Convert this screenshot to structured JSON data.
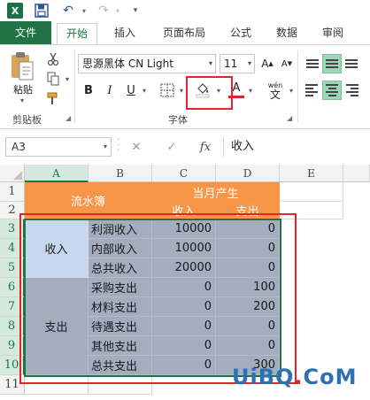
{
  "app": {
    "logo_letter": "X"
  },
  "qat": {
    "save_icon": "save-icon",
    "undo_icon": "undo-icon",
    "redo_icon": "redo-icon"
  },
  "tabs": [
    {
      "label": "文件"
    },
    {
      "label": "开始",
      "active": true
    },
    {
      "label": "插入"
    },
    {
      "label": "页面布局"
    },
    {
      "label": "公式"
    },
    {
      "label": "数据"
    },
    {
      "label": "审阅"
    }
  ],
  "ribbon": {
    "clipboard": {
      "paste_label": "粘贴",
      "group_label": "剪贴板"
    },
    "font": {
      "font_name": "思源黑体 CN Light",
      "font_size": "11",
      "bold": "B",
      "italic": "I",
      "underline": "U",
      "font_color_letter": "A",
      "phonetic_label": "wén",
      "group_label": "字体"
    },
    "highlight_color": "#e0262a",
    "accent_color": "#217346"
  },
  "formula_bar": {
    "name_box": "A3",
    "cancel": "✕",
    "confirm": "✓",
    "fx": "fx",
    "content": "收入"
  },
  "sheet": {
    "columns": [
      "A",
      "B",
      "C",
      "D",
      "E"
    ],
    "selected_column": "A",
    "rows": [
      "1",
      "2",
      "3",
      "4",
      "5",
      "6",
      "7",
      "8",
      "9",
      "10",
      "11"
    ],
    "title_cells": {
      "ledger": "流水簿",
      "current_month": "当月产生",
      "income_header": "收入",
      "expense_header": "支出"
    },
    "group_labels": {
      "income": "收入",
      "expense": "支出"
    },
    "data_rows": [
      {
        "label": "利润收入",
        "income": "10000",
        "expense": "0"
      },
      {
        "label": "内部收入",
        "income": "10000",
        "expense": "0"
      },
      {
        "label": "总共收入",
        "income": "20000",
        "expense": "0"
      },
      {
        "label": "采购支出",
        "income": "0",
        "expense": "100"
      },
      {
        "label": "材料支出",
        "income": "0",
        "expense": "200"
      },
      {
        "label": "待遇支出",
        "income": "0",
        "expense": "0"
      },
      {
        "label": "其他支出",
        "income": "0",
        "expense": "0"
      },
      {
        "label": "总共支出",
        "income": "0",
        "expense": "300"
      }
    ],
    "header_fill": "#f79646",
    "data_fill": "#a3adbe"
  },
  "watermark": {
    "left": "UiBQ",
    "dot": ".",
    "right": "CoM"
  }
}
